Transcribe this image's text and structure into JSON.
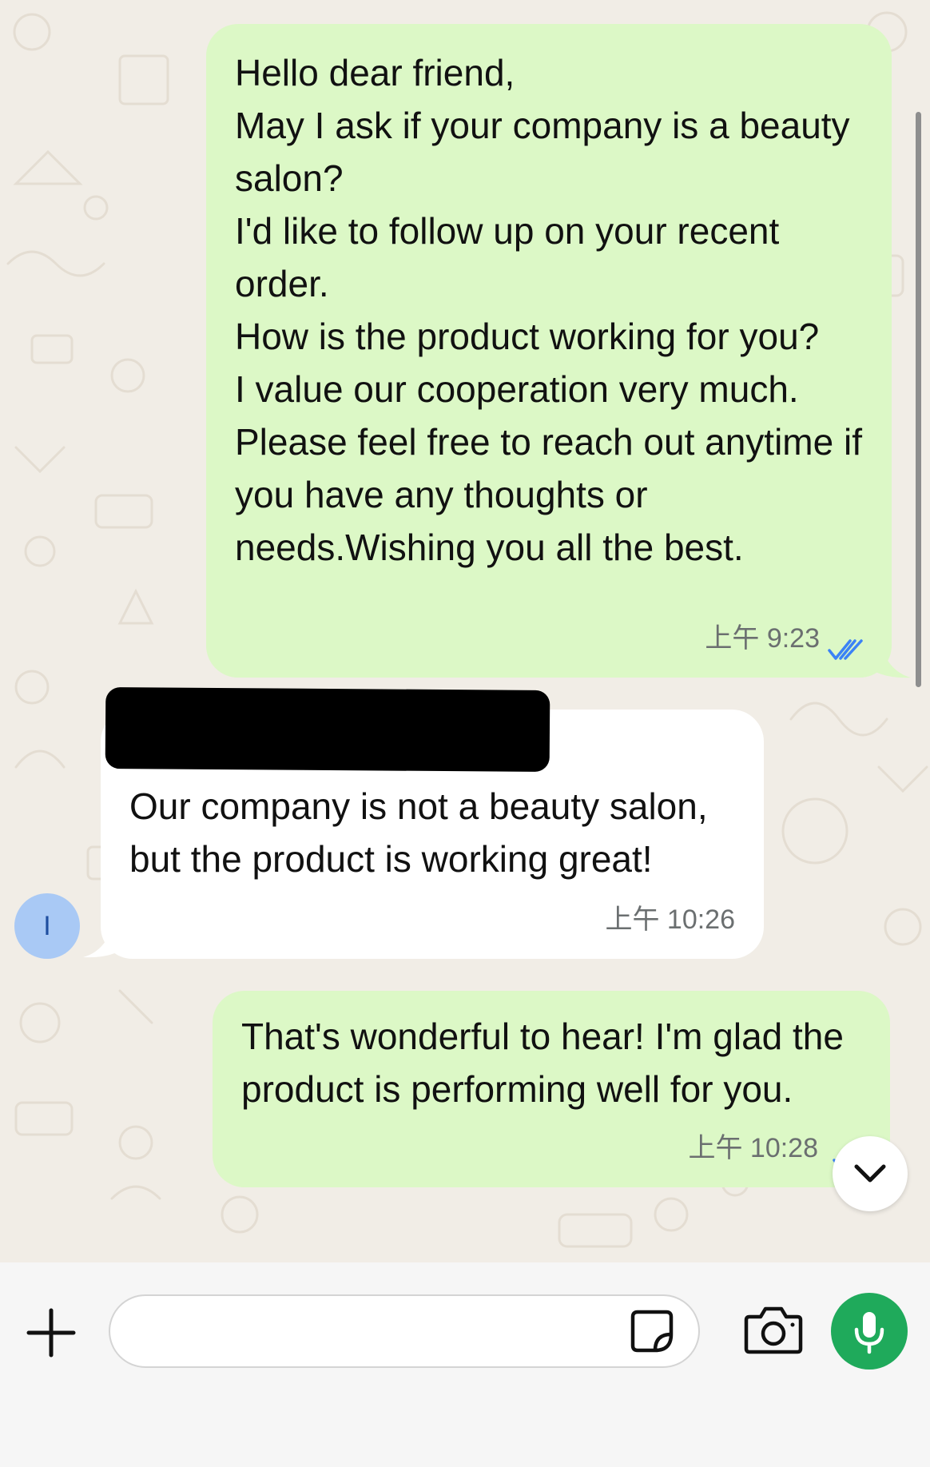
{
  "messages": [
    {
      "direction": "outgoing",
      "text": "Hello dear friend,\nMay I ask if your company is a beauty salon?\nI'd like to follow up on your recent order.\nHow is the product working for you?\nI value our cooperation very much.\nPlease feel free to reach out anytime if you have any thoughts or needs.Wishing you all the best.",
      "time": "上午 9:23",
      "status": "read"
    },
    {
      "direction": "incoming",
      "sender_redacted": true,
      "text": "Our company is not a beauty salon, but the product is working great!",
      "time": "上午 10:26"
    },
    {
      "direction": "outgoing",
      "text": "That's wonderful to hear! I'm glad the product is performing well for you.",
      "time": "上午 10:28",
      "status": "sent"
    }
  ],
  "avatar": {
    "initial": "I",
    "color": "#a9c9f5"
  },
  "composer": {
    "placeholder": ""
  },
  "icons": {
    "attach": "plus-icon",
    "sticker": "sticker-icon",
    "camera": "camera-icon",
    "mic": "microphone-icon",
    "scroll_down": "chevron-down-icon",
    "read_receipt": "double-check-icon"
  },
  "colors": {
    "outgoing_bubble": "#dcf8c6",
    "incoming_bubble": "#ffffff",
    "read_tick": "#3b82f6",
    "mic_button": "#1faa5b",
    "chat_background": "#f1ede6"
  }
}
